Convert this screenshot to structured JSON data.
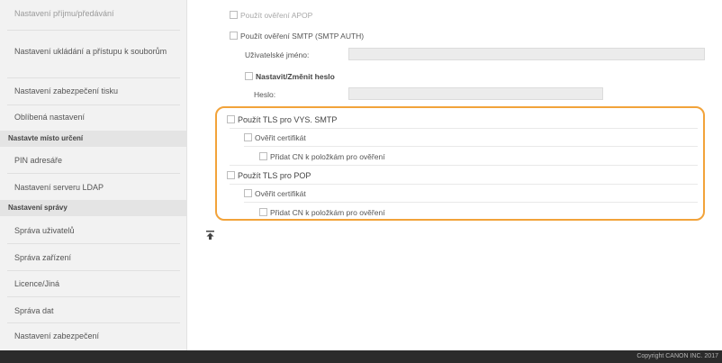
{
  "sidebar": {
    "items": [
      {
        "label": "Nastavení příjmu/předávání",
        "dim": true
      },
      {
        "label": "Nastavení ukládání a přístupu k souborům"
      },
      {
        "label": "Nastavení zabezpečení tisku"
      },
      {
        "label": "Oblíbená nastavení"
      }
    ],
    "group1_header": "Nastavte místo určení",
    "group1_items": [
      {
        "label": "PIN adresáře"
      },
      {
        "label": "Nastavení serveru LDAP"
      }
    ],
    "group2_header": "Nastavení správy",
    "group2_items": [
      {
        "label": "Správa uživatelů"
      },
      {
        "label": "Správa zařízení"
      },
      {
        "label": "Licence/Jiná"
      },
      {
        "label": "Správa dat"
      },
      {
        "label": "Nastavení zabezpečení"
      }
    ]
  },
  "form": {
    "apop_label": "Použít ověření APOP",
    "smtp_auth_label": "Použít ověření SMTP (SMTP AUTH)",
    "username_label": "Uživatelské jméno:",
    "username_value": "",
    "set_password_label": "Nastavit/Změnit heslo",
    "password_label": "Heslo:",
    "password_value": "",
    "tls_smtp_label": "Použít TLS pro VYS. SMTP",
    "verify_cert_label_1": "Ověřit certifikát",
    "add_cn_label_1": "Přidat CN k položkám pro ověření",
    "tls_pop_label": "Použít TLS pro POP",
    "verify_cert_label_2": "Ověřit certifikát",
    "add_cn_label_2": "Přidat CN k položkám pro ověření"
  },
  "back_to_top_icon": "arrow-to-top",
  "footer": {
    "copyright": "Copyright CANON INC. 2017"
  },
  "colors": {
    "highlight": "#f2a33a",
    "footer_bg": "#2b2b2b",
    "sidebar_bg": "#f2f2f2"
  }
}
